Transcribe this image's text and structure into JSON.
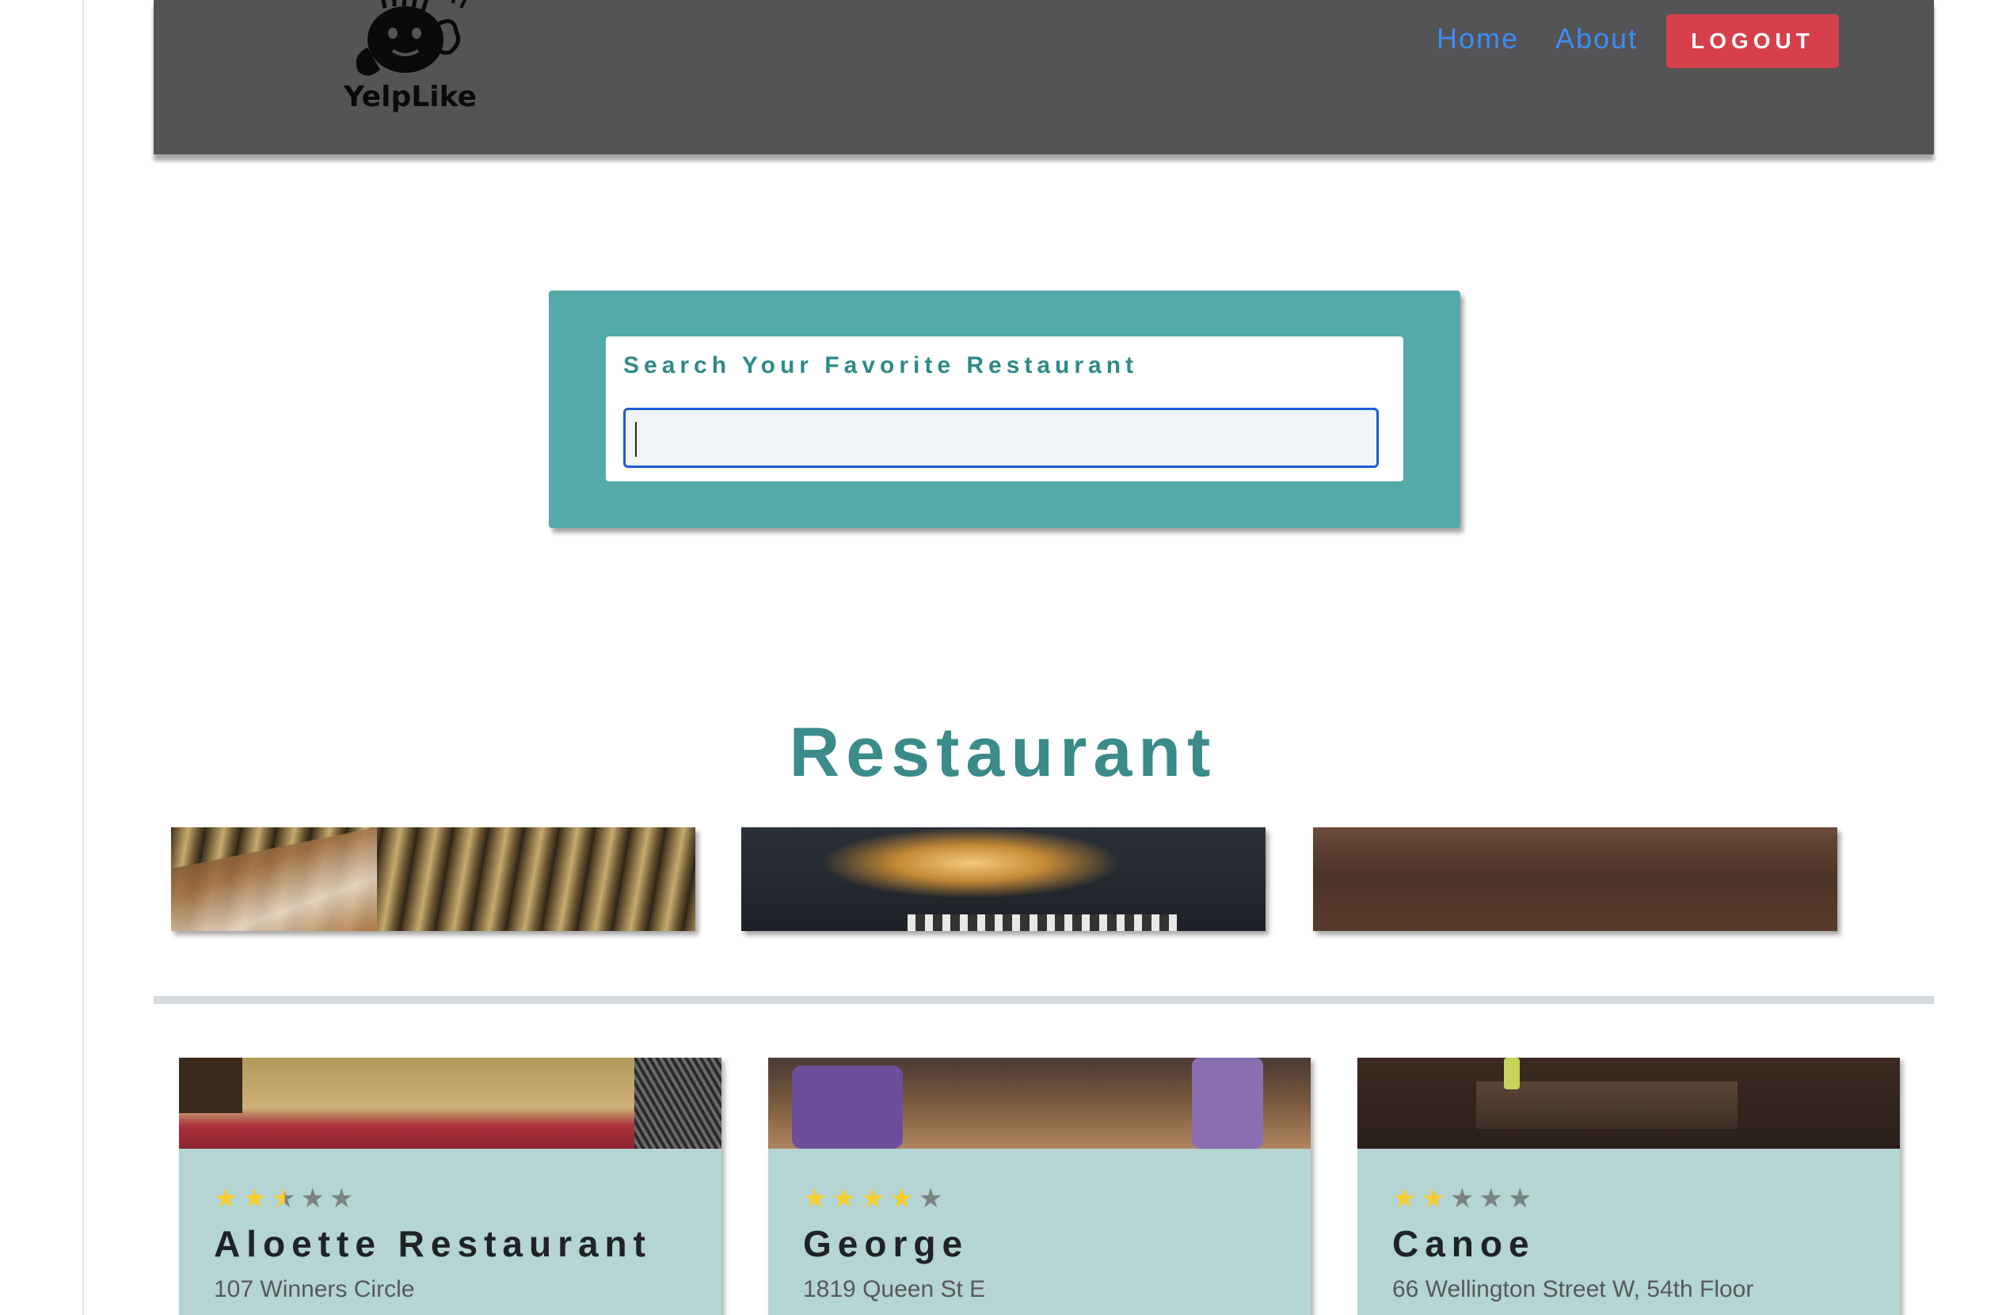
{
  "navbar": {
    "logo_text": "YelpLike",
    "links": [
      {
        "label": "Home"
      },
      {
        "label": "About"
      }
    ],
    "logout_label": "LOGOUT"
  },
  "search": {
    "label": "Search Your Favorite Restaurant",
    "value": "",
    "placeholder": ""
  },
  "section": {
    "title": "Restaurant"
  },
  "carousel": {
    "images": [
      {
        "icon": "restaurant-interior-photo"
      },
      {
        "icon": "chandelier-dining-photo"
      },
      {
        "icon": "dim-dining-room-photo"
      }
    ]
  },
  "cards": [
    {
      "name": "Aloette Restaurant",
      "address": "107 Winners Circle",
      "rating": 2.5,
      "max_rating": 5
    },
    {
      "name": "George",
      "address": "1819 Queen St E",
      "rating": 4,
      "max_rating": 5
    },
    {
      "name": "Canoe",
      "address": "66 Wellington Street W, 54th Floor",
      "rating": 2,
      "max_rating": 5
    }
  ],
  "colors": {
    "navbar_bg": "#545355",
    "nav_link": "#3d8cf5",
    "logout_bg": "#d6404a",
    "search_panel": "#53aaa9",
    "accent_teal": "#3a8b89",
    "card_bg": "#b5d4d4",
    "star_on": "#f6cd2e",
    "star_off": "#7b8383"
  }
}
